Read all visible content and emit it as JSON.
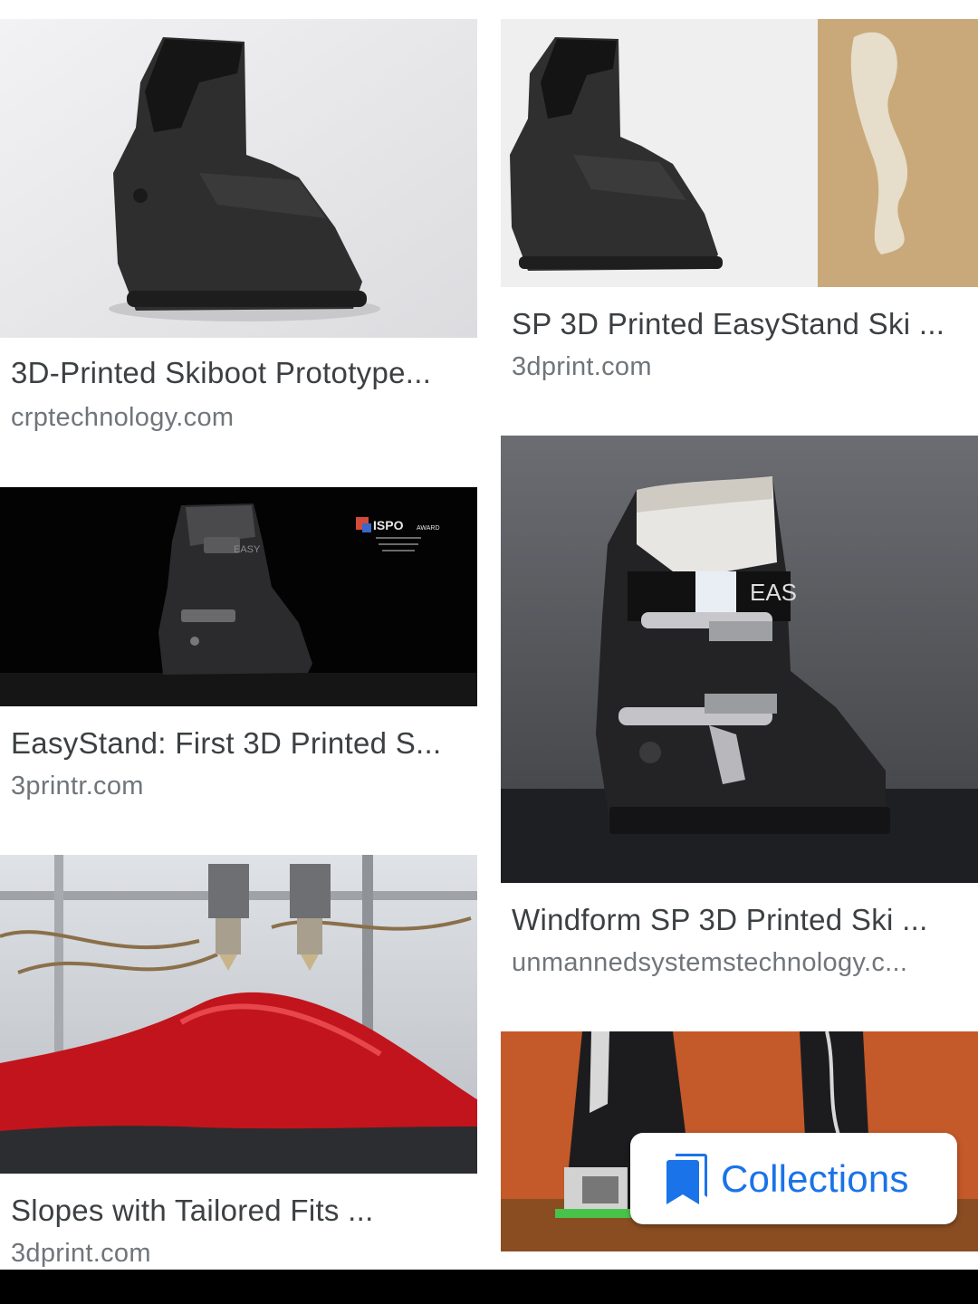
{
  "results": [
    {
      "title": "3D-Printed Skiboot Prototype...",
      "source": "crptechnology.com"
    },
    {
      "title": "SP 3D Printed EasyStand Ski ...",
      "source": "3dprint.com"
    },
    {
      "title": "EasyStand: First 3D Printed S...",
      "source": "3printr.com"
    },
    {
      "title": "Windform SP 3D Printed Ski ...",
      "source": "unmannedsystemstechnology.c..."
    },
    {
      "title": "Slopes with Tailored Fits ...",
      "source": "3dprint.com"
    },
    {
      "title": "",
      "source": ""
    }
  ],
  "image_text": {
    "ispo": "ISPO",
    "award": "AWARD",
    "boot_brand": "EAS",
    "boot_brand_small": "EASY"
  },
  "collections_button": {
    "label": "Collections",
    "icon": "bookmark-collections-icon"
  },
  "colors": {
    "title": "#3c4043",
    "source": "#70757a",
    "accent": "#1a73e8",
    "bottom_bar": "#000000"
  }
}
